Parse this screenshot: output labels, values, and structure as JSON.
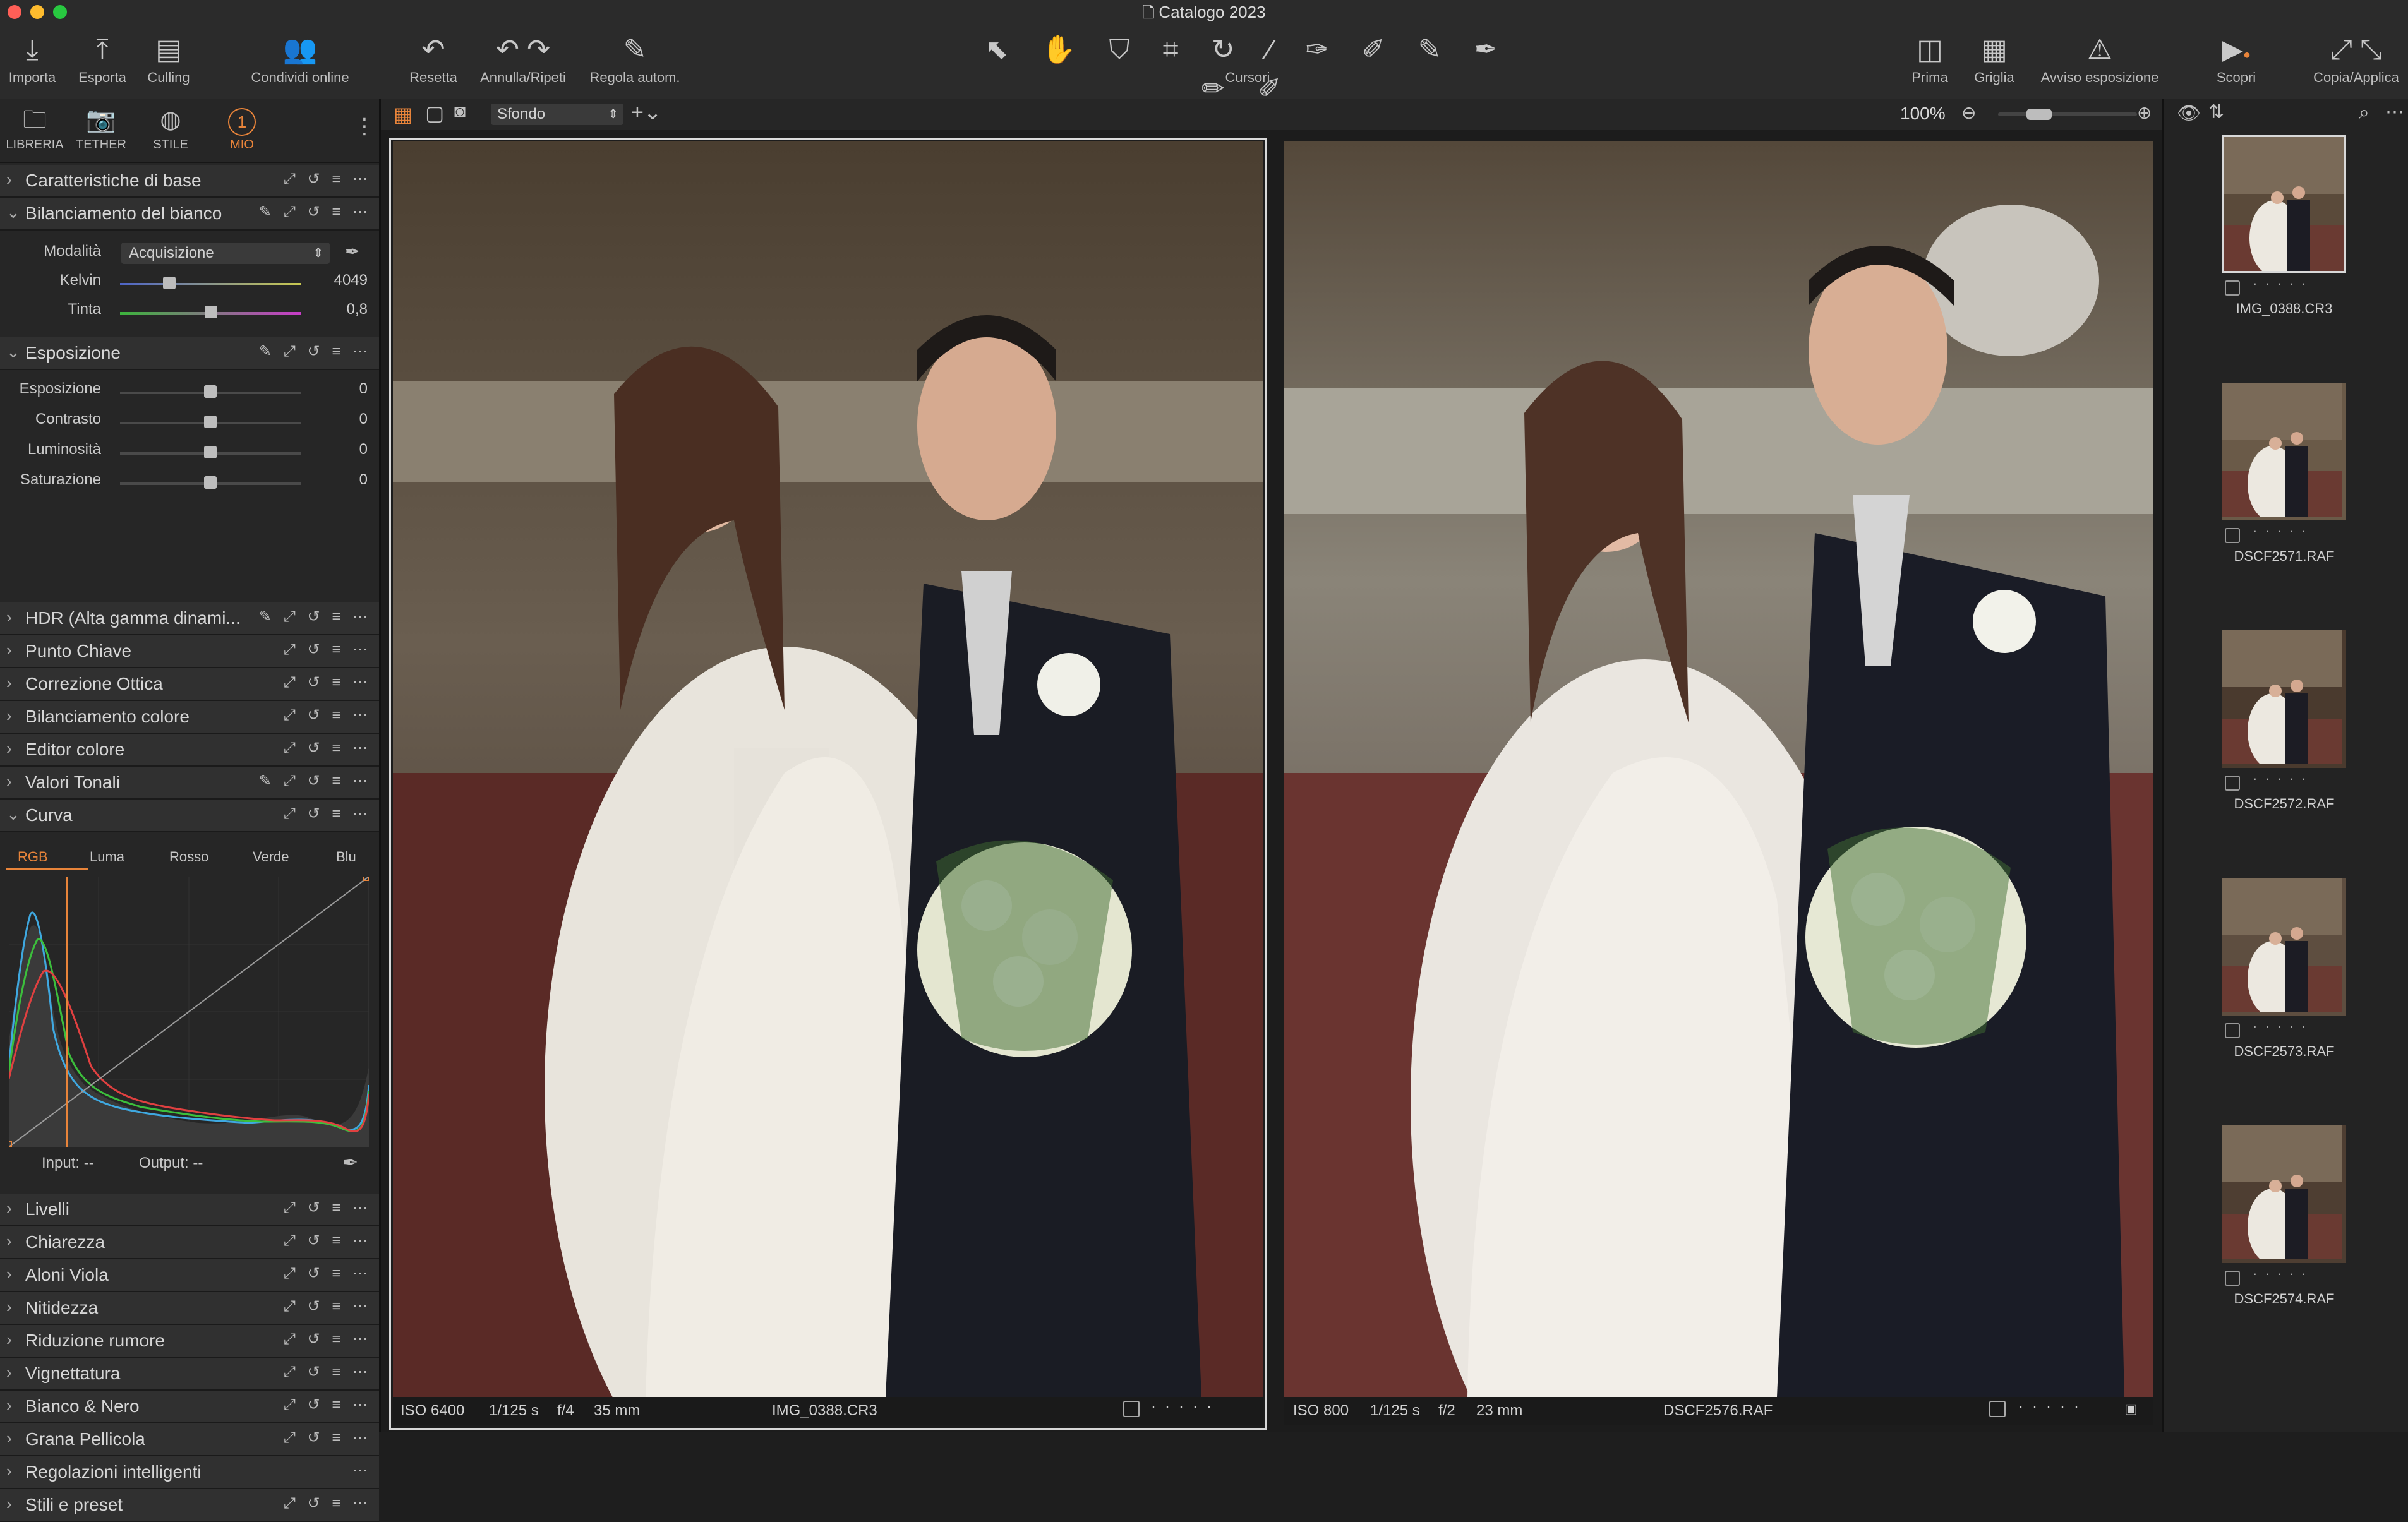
{
  "window": {
    "title": "Catalogo 2023"
  },
  "toolbar": {
    "import": "Importa",
    "export": "Esporta",
    "culling": "Culling",
    "share": "Condividi online",
    "reset": "Resetta",
    "undo_redo": "Annulla/Ripeti",
    "auto_adjust": "Regola autom.",
    "cursors": "Cursori",
    "before": "Prima",
    "grid": "Griglia",
    "exposure_warning": "Avviso esposizione",
    "discover": "Scopri",
    "copy_apply": "Copia/Applica"
  },
  "tool_tabs": [
    {
      "label": "LIBRERIA"
    },
    {
      "label": "TETHER"
    },
    {
      "label": "STILE"
    },
    {
      "label": "MIO",
      "number": "1"
    }
  ],
  "panels": {
    "basic": "Caratteristiche di base",
    "white_balance": {
      "title": "Bilanciamento del bianco",
      "mode_label": "Modalità",
      "mode_value": "Acquisizione",
      "kelvin_label": "Kelvin",
      "kelvin_value": "4049",
      "tint_label": "Tinta",
      "tint_value": "0,8"
    },
    "exposure": {
      "title": "Esposizione",
      "rows": [
        {
          "label": "Esposizione",
          "value": "0"
        },
        {
          "label": "Contrasto",
          "value": "0"
        },
        {
          "label": "Luminosità",
          "value": "0"
        },
        {
          "label": "Saturazione",
          "value": "0"
        }
      ]
    },
    "collapsed_1": [
      "HDR (Alta gamma dinami...",
      "Punto Chiave",
      "Correzione Ottica",
      "Bilanciamento colore",
      "Editor colore"
    ],
    "valori_tonali": "Valori Tonali",
    "curve": {
      "title": "Curva",
      "tabs": [
        "RGB",
        "Luma",
        "Rosso",
        "Verde",
        "Blu"
      ],
      "input_label": "Input:",
      "input_value": "--",
      "output_label": "Output:",
      "output_value": "--"
    },
    "collapsed_2": [
      "Livelli",
      "Chiarezza",
      "Aloni Viola",
      "Nitidezza",
      "Riduzione rumore",
      "Vignettatura",
      "Bianco & Nero",
      "Grana Pellicola",
      "Regolazioni intelligenti",
      "Stili e preset"
    ]
  },
  "viewer": {
    "background_select": "Sfondo",
    "zoom": "100%",
    "left_image": {
      "iso": "ISO 6400",
      "shutter": "1/125 s",
      "aperture": "f/4",
      "focal": "35 mm",
      "filename": "IMG_0388.CR3"
    },
    "right_image": {
      "iso": "ISO 800",
      "shutter": "1/125 s",
      "aperture": "f/2",
      "focal": "23 mm",
      "filename": "DSCF2576.RAF"
    }
  },
  "browser": {
    "thumbnails": [
      "IMG_0388.CR3",
      "DSCF2571.RAF",
      "DSCF2572.RAF",
      "DSCF2573.RAF",
      "DSCF2574.RAF"
    ]
  },
  "colors": {
    "accent": "#e8843a",
    "bg": "#1e1e1e",
    "panel": "#262626"
  }
}
